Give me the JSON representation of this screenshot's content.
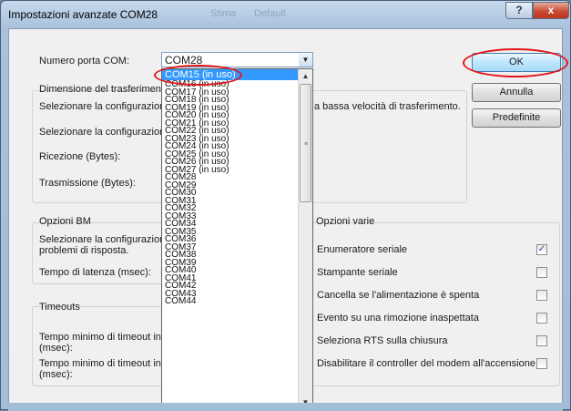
{
  "window": {
    "title": "Impostazioni avanzate COM28",
    "ghost_text": [
      "Stima",
      "Default"
    ],
    "help_glyph": "?",
    "close_glyph": "x"
  },
  "port": {
    "label": "Numero porta COM:",
    "value": "COM28",
    "options": [
      "COM15 (in uso)",
      "COM16 (in uso)",
      "COM17 (in uso)",
      "COM18 (in uso)",
      "COM19 (in uso)",
      "COM20 (in uso)",
      "COM21 (in uso)",
      "COM22 (in uso)",
      "COM23 (in uso)",
      "COM24 (in uso)",
      "COM25 (in uso)",
      "COM26 (in uso)",
      "COM27 (in uso)",
      "COM28",
      "COM29",
      "COM30",
      "COM31",
      "COM32",
      "COM33",
      "COM34",
      "COM35",
      "COM36",
      "COM37",
      "COM38",
      "COM39",
      "COM40",
      "COM41",
      "COM42",
      "COM43",
      "COM44"
    ],
    "selected_index": 0
  },
  "transfer": {
    "title": "Dimensione del trasferimento",
    "line1": "Selezionare la configurazione",
    "line1_tail": "a bassa velocità di trasferimento.",
    "line2": "Selezionare la configurazione",
    "rx_label": "Ricezione (Bytes):",
    "tx_label": "Trasmissione (Bytes):"
  },
  "bm": {
    "title": "Opzioni BM",
    "line1": "Selezionare la configurazione",
    "line2": "problemi di risposta.",
    "latency_label": "Tempo di latenza (msec):"
  },
  "timeouts": {
    "title": "Timeouts",
    "read_line1": "Tempo minimo di timeout in le",
    "read_line2": "(msec):",
    "write_line1": "Tempo minimo di timeout in s",
    "write_line2": "(msec):"
  },
  "misc": {
    "title": "Opzioni varie",
    "options": [
      {
        "label": "Enumeratore seriale",
        "checked": true
      },
      {
        "label": "Stampante seriale",
        "checked": false
      },
      {
        "label": "Cancella se l'alimentazione è spenta",
        "checked": false
      },
      {
        "label": "Evento su una rimozione inaspettata",
        "checked": false
      },
      {
        "label": "Seleziona RTS sulla chiusura",
        "checked": false
      },
      {
        "label": "Disabilitare il controller del modem all'accensione",
        "checked": false
      }
    ]
  },
  "buttons": {
    "ok": "OK",
    "cancel": "Annulla",
    "defaults": "Predefinite"
  },
  "icons": {
    "dropdown": "chevron-down-icon",
    "scroll_up": "arrow-up-icon",
    "scroll_down": "arrow-down-icon",
    "check": "checkmark-icon"
  },
  "colors": {
    "highlight_ring": "#e0171b",
    "selection": "#3399ff"
  }
}
